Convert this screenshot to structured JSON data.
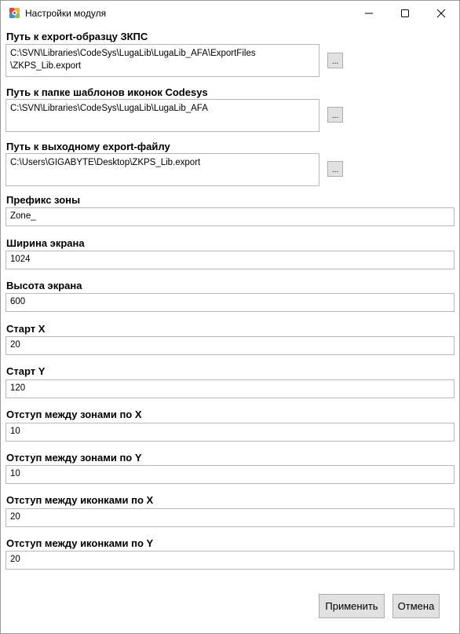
{
  "window": {
    "title": "Настройки модуля",
    "controls": {
      "minimize": "minimize",
      "maximize": "maximize",
      "close": "close"
    }
  },
  "fields": {
    "export_sample_path": {
      "label": "Путь к export-образцу ЗКПС",
      "value": "C:\\SVN\\Libraries\\CodeSys\\LugaLib\\LugaLib_AFA\\ExportFiles\n\\ZKPS_Lib.export",
      "browse_label": "..."
    },
    "icon_templates_path": {
      "label": "Путь к папке шаблонов иконок Codesys",
      "value": "C:\\SVN\\Libraries\\CodeSys\\LugaLib\\LugaLib_AFA",
      "browse_label": "..."
    },
    "output_export_path": {
      "label": "Путь к выходному export-файлу",
      "value": "C:\\Users\\GIGABYTE\\Desktop\\ZKPS_Lib.export",
      "browse_label": "..."
    },
    "zone_prefix": {
      "label": "Префикс зоны",
      "value": "Zone_"
    },
    "screen_width": {
      "label": "Ширина экрана",
      "value": "1024"
    },
    "screen_height": {
      "label": "Высота экрана",
      "value": "600"
    },
    "start_x": {
      "label": "Старт X",
      "value": "20"
    },
    "start_y": {
      "label": "Старт Y",
      "value": "120"
    },
    "zone_spacing_x": {
      "label": "Отступ между зонами по X",
      "value": "10"
    },
    "zone_spacing_y": {
      "label": "Отступ между зонами по Y",
      "value": "10"
    },
    "icon_spacing_x": {
      "label": "Отступ между иконками по X",
      "value": "20"
    },
    "icon_spacing_y": {
      "label": "Отступ между иконками по Y",
      "value": "20"
    }
  },
  "buttons": {
    "apply": "Применить",
    "cancel": "Отмена"
  },
  "icons": {
    "app": "gear-cube-icon",
    "browse": "ellipsis"
  }
}
